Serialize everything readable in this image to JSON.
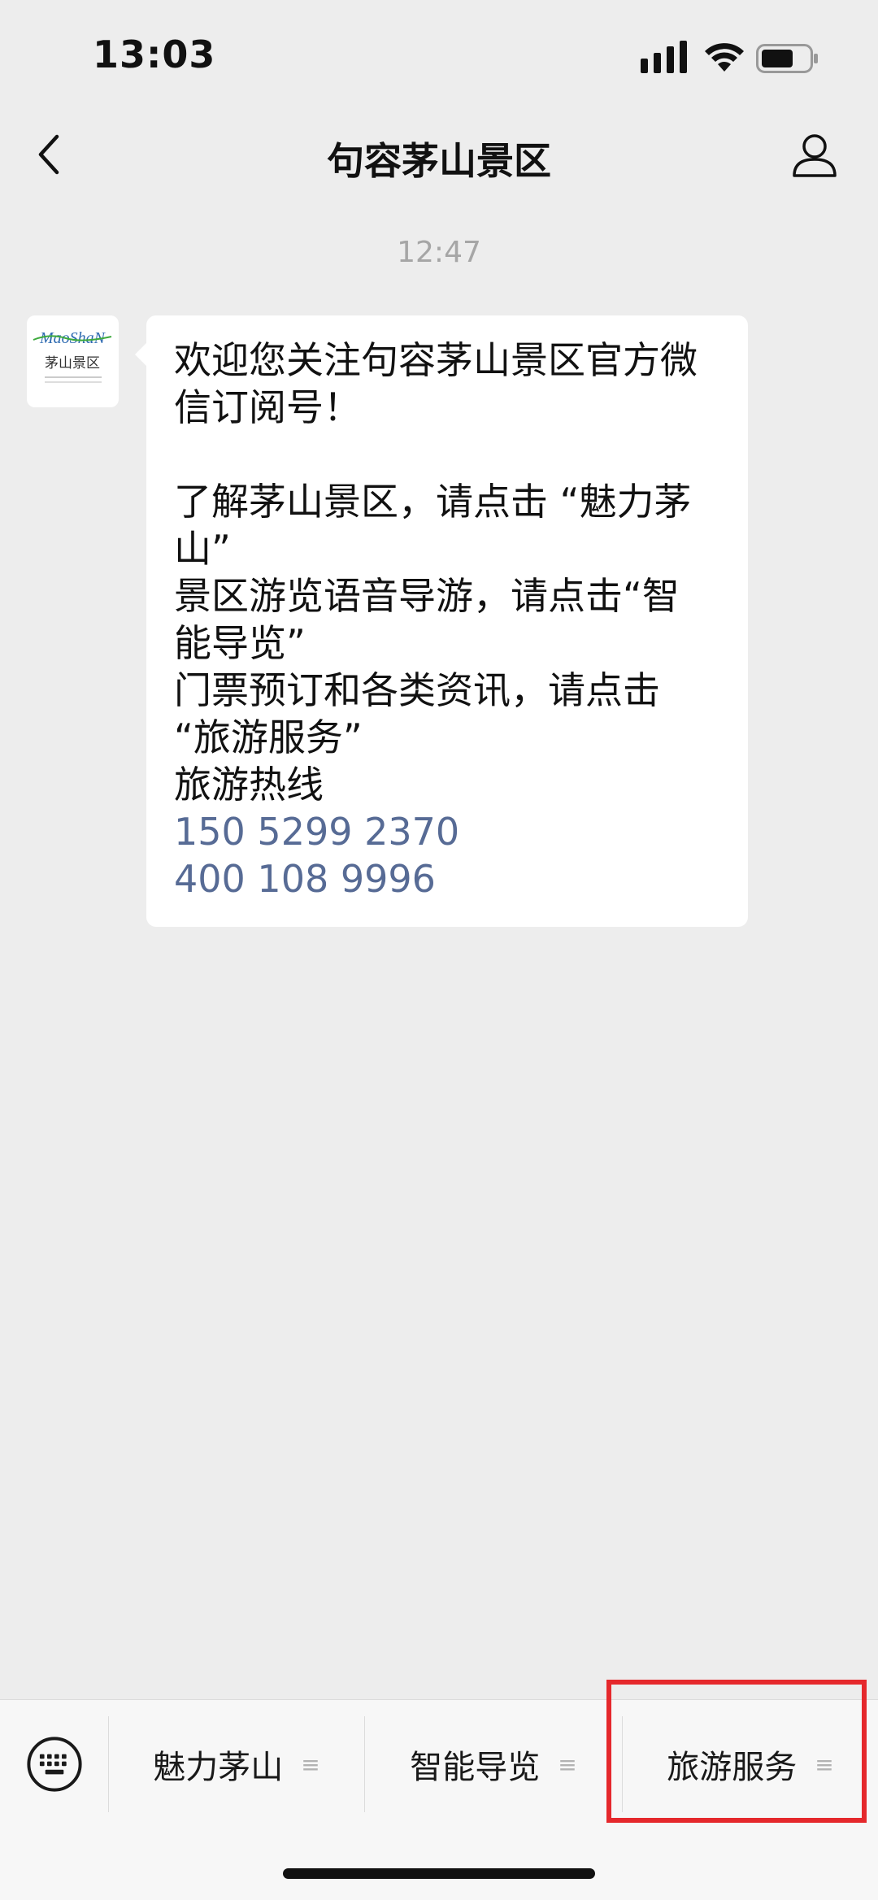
{
  "status_bar": {
    "time": "13:03",
    "icons": [
      "signal-icon",
      "wifi-icon",
      "battery-icon"
    ]
  },
  "nav": {
    "title": "句容茅山景区",
    "back_icon": "chevron-left-icon",
    "profile_icon": "person-icon"
  },
  "chat": {
    "timestamp": "12:47",
    "avatar": {
      "logo_text": "MaoShaN",
      "sub_text": "茅山景区"
    },
    "message": {
      "lines": [
        "欢迎您关注句容茅山景区官方微",
        "信订阅号！",
        "",
        "了解茅山景区，请点击 “魅力茅",
        "山”",
        "景区游览语音导游，请点击“智",
        "能导览”",
        "门票预订和各类资讯，请点击",
        "“旅游服务”",
        "旅游热线"
      ],
      "phones": [
        "150 5299 2370",
        "400 108 9996"
      ]
    }
  },
  "menu": {
    "keyboard_icon": "keyboard-icon",
    "items": [
      {
        "label": "魅力茅山",
        "glyph": "≡"
      },
      {
        "label": "智能导览",
        "glyph": "≡"
      },
      {
        "label": "旅游服务",
        "glyph": "≡"
      }
    ],
    "highlight_color": "#E5282C"
  },
  "colors": {
    "background": "#EDEDED",
    "link": "#576B95",
    "menu_bg": "#F7F7F7"
  }
}
